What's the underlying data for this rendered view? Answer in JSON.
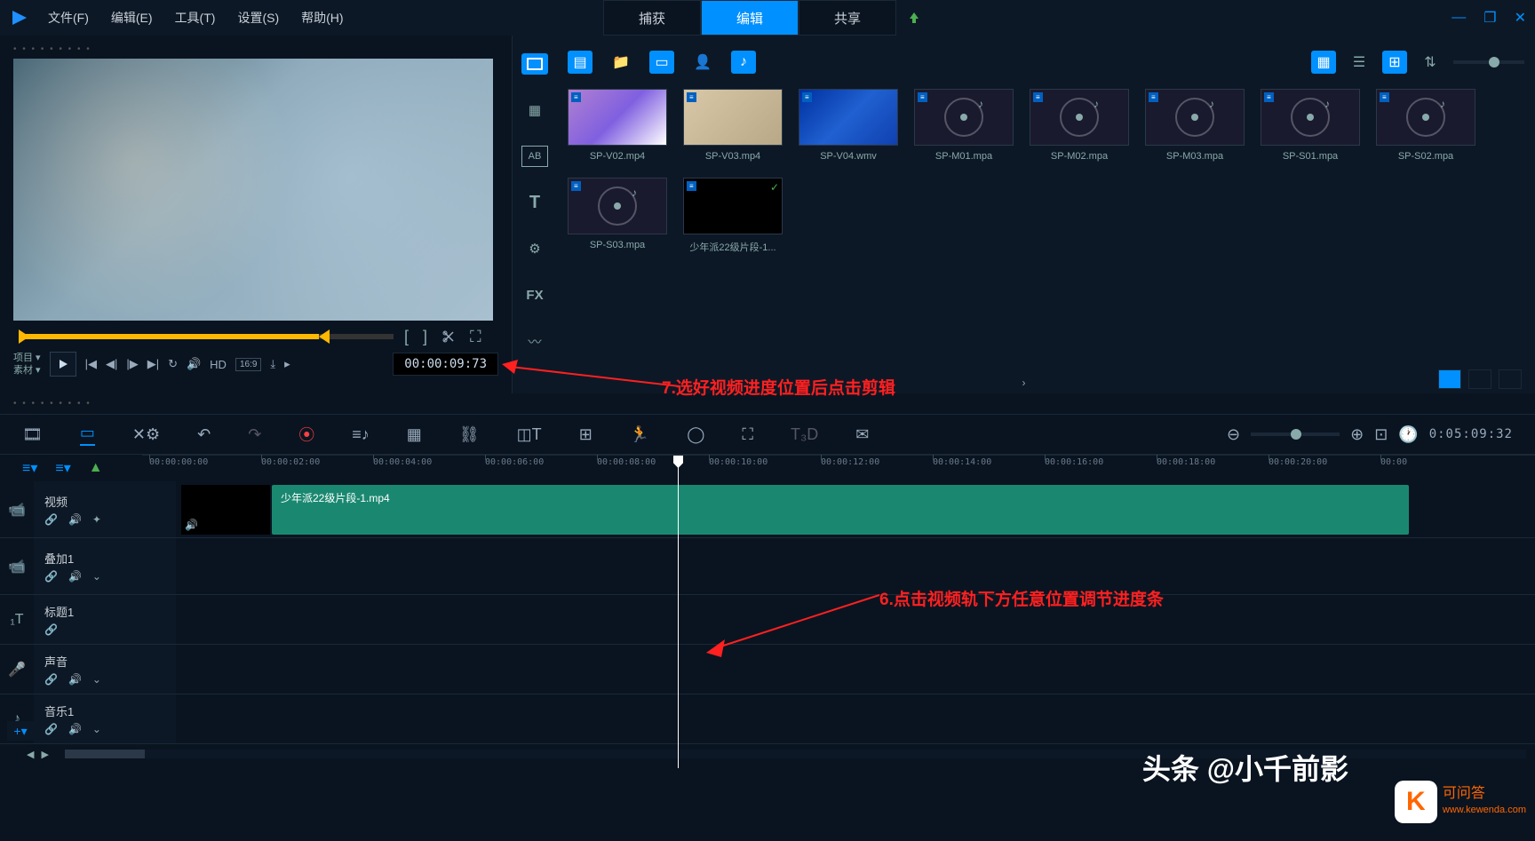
{
  "menu": {
    "file": "文件(F)",
    "edit": "编辑(E)",
    "tool": "工具(T)",
    "settings": "设置(S)",
    "help": "帮助(H)"
  },
  "tabs": {
    "capture": "捕获",
    "edit": "编辑",
    "share": "共享"
  },
  "preview": {
    "project": "项目 ▾",
    "material": "素材 ▾",
    "hd": "HD",
    "ratio": "16:9",
    "timecode": "00:00:09:73"
  },
  "library": {
    "items": [
      {
        "label": "SP-V02.mp4",
        "type": "video",
        "cls": "vthumb1"
      },
      {
        "label": "SP-V03.mp4",
        "type": "video",
        "cls": "vthumb2"
      },
      {
        "label": "SP-V04.wmv",
        "type": "video",
        "cls": "vthumb3"
      },
      {
        "label": "SP-M01.mpa",
        "type": "audio"
      },
      {
        "label": "SP-M02.mpa",
        "type": "audio"
      },
      {
        "label": "SP-M03.mpa",
        "type": "audio"
      },
      {
        "label": "SP-S01.mpa",
        "type": "audio"
      },
      {
        "label": "SP-S02.mpa",
        "type": "audio"
      },
      {
        "label": "SP-S03.mpa",
        "type": "audio"
      },
      {
        "label": "少年派22级片段-1...",
        "type": "video",
        "cls": "vthumb4",
        "check": true
      }
    ]
  },
  "toolbar_right_timecode": "0:05:09:32",
  "ruler": [
    "00:00:00:00",
    "00:00:02:00",
    "00:00:04:00",
    "00:00:06:00",
    "00:00:08:00",
    "00:00:10:00",
    "00:00:12:00",
    "00:00:14:00",
    "00:00:16:00",
    "00:00:18:00",
    "00:00:20:00",
    "00:00"
  ],
  "tracks": {
    "video": "视频",
    "overlay": "叠加1",
    "title": "标题1",
    "voice": "声音",
    "music": "音乐1"
  },
  "clip_name": "少年派22级片段-1.mp4",
  "annotations": {
    "a7": "7.选好视频进度位置后点击剪辑",
    "a6": "6.点击视频轨下方任意位置调节进度条"
  },
  "watermark": {
    "headline": "头条 @小千前影",
    "k": "K",
    "site_cn": "可问答",
    "site_url": "www.kewenda.com"
  }
}
